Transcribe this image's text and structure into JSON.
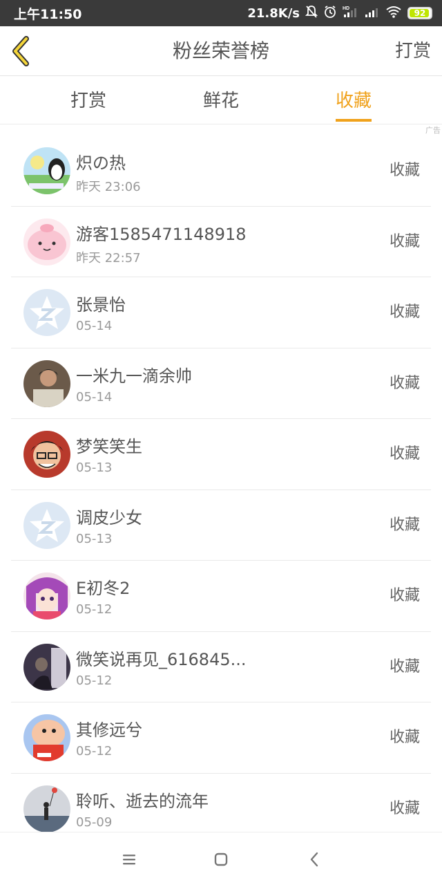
{
  "status_bar": {
    "time": "上午11:50",
    "network_speed": "21.8K/s",
    "hd_label": "HD",
    "battery": "92",
    "icons": [
      "mute-bell-icon",
      "alarm-icon",
      "signal-icon",
      "signal-icon",
      "wifi-icon",
      "battery-icon"
    ]
  },
  "header": {
    "title": "粉丝荣誉榜",
    "action": "打赏",
    "back_icon": "chevron-left-icon",
    "accent_color": "#f0a21c"
  },
  "tabs": [
    {
      "label": "打赏",
      "active": false
    },
    {
      "label": "鲜花",
      "active": false
    },
    {
      "label": "收藏",
      "active": true
    }
  ],
  "ad_label": "广告",
  "fans": [
    {
      "name": "炽の热",
      "time": "昨天 23:06",
      "action": "收藏"
    },
    {
      "name": "游客1585471148918",
      "time": "昨天 22:57",
      "action": "收藏"
    },
    {
      "name": "张景怡",
      "time": "05-14",
      "action": "收藏"
    },
    {
      "name": "一米九一滴余帅",
      "time": "05-14",
      "action": "收藏"
    },
    {
      "name": "梦笑笑生",
      "time": "05-13",
      "action": "收藏"
    },
    {
      "name": "调皮少女",
      "time": "05-13",
      "action": "收藏"
    },
    {
      "name": "E初冬2",
      "time": "05-12",
      "action": "收藏"
    },
    {
      "name": "微笑说再见_616845...",
      "time": "05-12",
      "action": "收藏"
    },
    {
      "name": "其修远兮",
      "time": "05-12",
      "action": "收藏"
    },
    {
      "name": "聆听、逝去的流年",
      "time": "05-09",
      "action": "收藏"
    }
  ],
  "nav_bar": {
    "icons": [
      "menu-icon",
      "home-icon",
      "back-icon"
    ]
  }
}
